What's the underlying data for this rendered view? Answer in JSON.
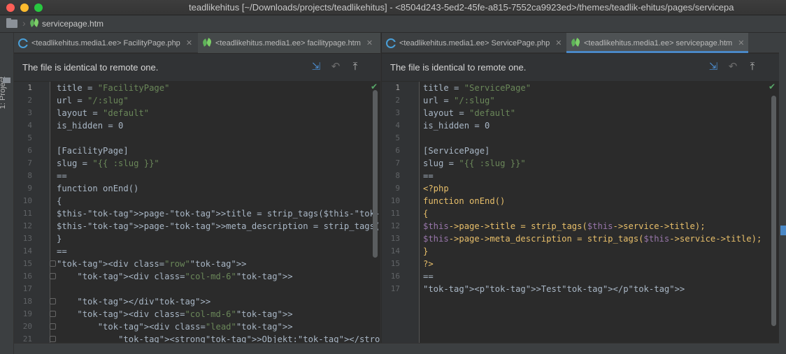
{
  "window": {
    "title": "teadlikehitus [~/Downloads/projects/teadlikehitus] - <8504d243-5ed2-45fe-a815-7552ca9923ed>/themes/teadlik-ehitus/pages/servicepa"
  },
  "navbar": {
    "file": "servicepage.htm"
  },
  "sidebar": {
    "project_label": "1: Project"
  },
  "left_pane": {
    "tabs": [
      {
        "label": "<teadlikehitus.media1.ee> FacilityPage.php",
        "icon": "php-class-icon"
      },
      {
        "label": "<teadlikehitus.media1.ee> facilitypage.htm",
        "icon": "october-leaf-icon"
      }
    ],
    "info": "The file is identical to remote one.",
    "line_numbers": [
      "1",
      "2",
      "3",
      "4",
      "5",
      "6",
      "7",
      "8",
      "9",
      "10",
      "11",
      "12",
      "13",
      "14",
      "15",
      "16",
      "17",
      "18",
      "19",
      "20",
      "21"
    ],
    "lines": [
      "title = \"FacilityPage\"",
      "url = \"/:slug\"",
      "layout = \"default\"",
      "is_hidden = 0",
      "",
      "[FacilityPage]",
      "slug = \"{{ :slug }}\"",
      "==",
      "function onEnd()",
      "{",
      "$this->page->title = strip_tags($this->facility->title);",
      "$this->page->meta_description = strip_tags($this->facility->title);",
      "}",
      "==",
      "<div class=\"row\">",
      "    <div class=\"col-md-6\">",
      "",
      "    </div>",
      "    <div class=\"col-md-6\">",
      "        <div class=\"lead\">",
      "            <strong>Objekt:</strong> {{ facility.title }}<br>"
    ]
  },
  "right_pane": {
    "tabs": [
      {
        "label": "<teadlikehitus.media1.ee> ServicePage.php",
        "icon": "php-class-icon"
      },
      {
        "label": "<teadlikehitus.media1.ee> servicepage.htm",
        "icon": "october-leaf-icon"
      }
    ],
    "info": "The file is identical to remote one.",
    "line_numbers": [
      "1",
      "2",
      "3",
      "4",
      "5",
      "6",
      "7",
      "8",
      "9",
      "10",
      "11",
      "12",
      "13",
      "14",
      "15",
      "16",
      "17"
    ],
    "lines": [
      "title = \"ServicePage\"",
      "url = \"/:slug\"",
      "layout = \"default\"",
      "is_hidden = 0",
      "",
      "[ServicePage]",
      "slug = \"{{ :slug }}\"",
      "==",
      "<?php",
      "function onEnd()",
      "{",
      "$this->page->title = strip_tags($this->service->title);",
      "$this->page->meta_description = strip_tags($this->service->title);",
      "}",
      "?>",
      "==",
      "<p>Test</p>"
    ]
  },
  "colors": {
    "accent": "#4a88c7",
    "editor_bg": "#2b2b2b",
    "string": "#6a8759",
    "tag": "#e8bf6a",
    "keyword": "#cc7832"
  }
}
